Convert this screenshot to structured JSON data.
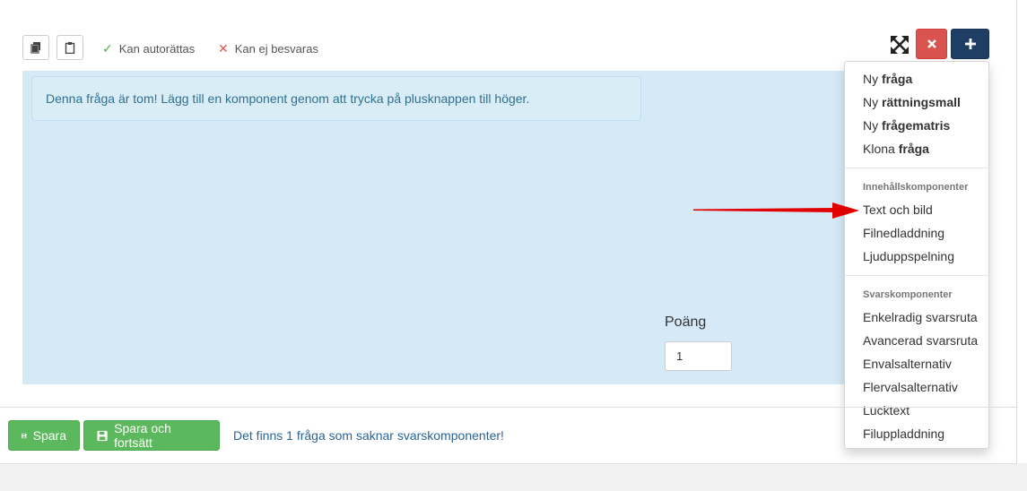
{
  "toolbar": {
    "copy_icon": "copy-icon",
    "paste_icon": "clipboard-icon",
    "status_autocorrect": "Kan autorättas",
    "status_unanswerable": "Kan ej besvaras"
  },
  "question": {
    "empty_message": "Denna fråga är tom! Lägg till en komponent genom att trycka på plusknappen till höger.",
    "points_label": "Poäng",
    "points_value": "1"
  },
  "menu": {
    "item_new_question": {
      "prefix": "Ny",
      "bold": "fråga"
    },
    "item_new_template": {
      "prefix": "Ny",
      "bold": "rättningsmall"
    },
    "item_new_matrix": {
      "prefix": "Ny",
      "bold": "frågematris"
    },
    "item_clone": {
      "prefix": "Klona",
      "bold": "fråga"
    },
    "header_content": "Innehållskomponenter",
    "content_items": [
      "Text och bild",
      "Filnedladdning",
      "Ljuduppspelning"
    ],
    "header_answer": "Svarskomponenter",
    "answer_items": [
      "Enkelradig svarsruta",
      "Avancerad svarsruta",
      "Envalsalternativ",
      "Flervalsalternativ",
      "Lucktext",
      "Filuppladdning"
    ]
  },
  "footer": {
    "save_label": "Spara",
    "save_continue_label": "Spara och fortsätt",
    "warning": "Det finns 1 fråga som saknar svarskomponenter!"
  },
  "colors": {
    "accent_blue": "#1f3e66",
    "danger": "#d9534f",
    "success": "#5cb85c",
    "info_bg": "#d6e9f6",
    "arrow": "#e00000"
  }
}
